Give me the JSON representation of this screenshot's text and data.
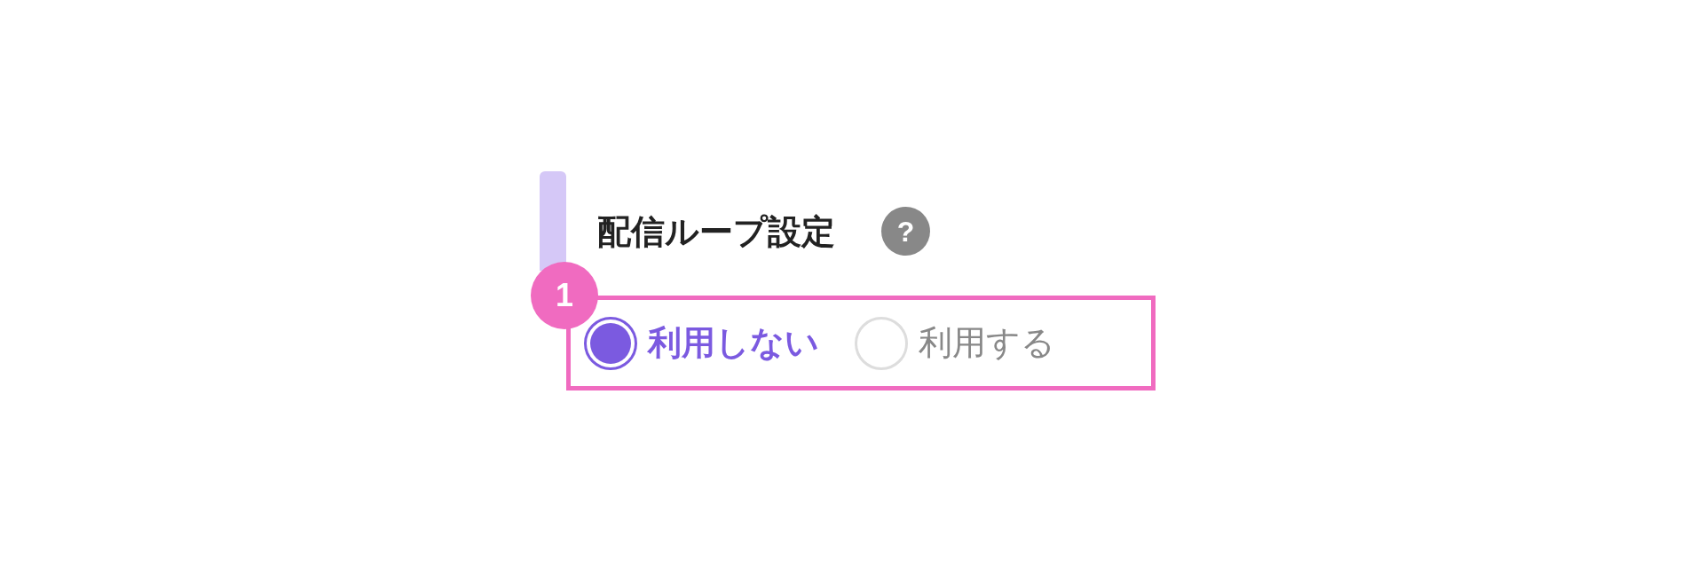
{
  "section": {
    "title": "配信ループ設定",
    "help_icon": "?"
  },
  "callout": {
    "number": "1"
  },
  "options": [
    {
      "label": "利用しない",
      "selected": true
    },
    {
      "label": "利用する",
      "selected": false
    }
  ]
}
